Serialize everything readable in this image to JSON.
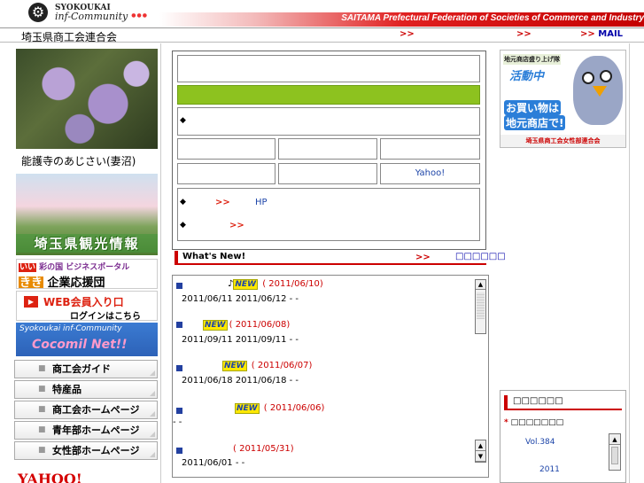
{
  "header": {
    "logo_top": "SYOKOUKAI",
    "logo_bottom": "inf-Community",
    "tagline": "SAITAMA Prefectural Federation of Societies of Commerce and Industry"
  },
  "subhead": {
    "title": "埼玉県商工会連合会",
    "arrow1": ">>",
    "arrow2": ">>",
    "mail_arrow": ">>",
    "mail_label": "MAIL"
  },
  "left": {
    "photo_caption": "能護寺のあじさい(妻沼)",
    "tourism_label": "埼玉県観光情報",
    "iiki": {
      "line1_mark": "いい",
      "line1": "彩の国 ビジネスポータル",
      "line2_mark": "きき",
      "line2": "企業応援団"
    },
    "web": {
      "icon": "▶",
      "line1": "WEB会員入り口",
      "line2": "ログインはこちら"
    },
    "cocomil": {
      "line1": "Syokoukai inf-Community",
      "line2": "Cocomil Net!!"
    },
    "menu": [
      {
        "label": "商工会ガイド"
      },
      {
        "label": "特産品"
      },
      {
        "label": "商工会ホームページ"
      },
      {
        "label": "青年部ホームページ"
      },
      {
        "label": "女性部ホームページ"
      }
    ],
    "yahoo_logo": "YAHOO!"
  },
  "center": {
    "bullet": "◆",
    "cells": [
      "",
      "",
      "",
      "",
      "",
      "Yahoo!"
    ],
    "links": {
      "arrow1": ">>",
      "hp": "HP",
      "arrow2": ">>"
    },
    "whatsnew": {
      "title": "What's New!",
      "arrow": ">>",
      "more": "□□□□□□"
    },
    "news": [
      {
        "prefix": "♪",
        "badge": "NEW",
        "date": "( 2011/06/10)",
        "detail": "2011/06/11 2011/06/12 -   -"
      },
      {
        "prefix": "",
        "badge": "NEW",
        "date": "( 2011/06/08)",
        "detail": "2011/09/11 2011/09/11 -   -"
      },
      {
        "prefix": "",
        "badge": "NEW",
        "date": "( 2011/06/07)",
        "detail": "2011/06/18 2011/06/18 -   -"
      },
      {
        "prefix": "",
        "badge": "NEW",
        "date": "( 2011/06/06)",
        "detail": "-   -"
      },
      {
        "prefix": "",
        "badge": "",
        "date": "( 2011/05/31)",
        "detail": "2011/06/01 -   -"
      }
    ]
  },
  "right": {
    "banner": {
      "caption_small": "地元商店盛り上げ隊",
      "caption_big": "活動中",
      "line1": "お買い物は",
      "line2": "地元商店で!",
      "footer": "埼玉県商工会女性部連合会"
    },
    "box": {
      "title": "□□□□□□",
      "sub_mark": "*",
      "sub": "□□□□□□□",
      "vol": "Vol.384",
      "year": "2011"
    }
  },
  "colors": {
    "accent_red": "#cc0000",
    "green_bar": "#8dc21f",
    "link_blue": "#1c44a8"
  }
}
